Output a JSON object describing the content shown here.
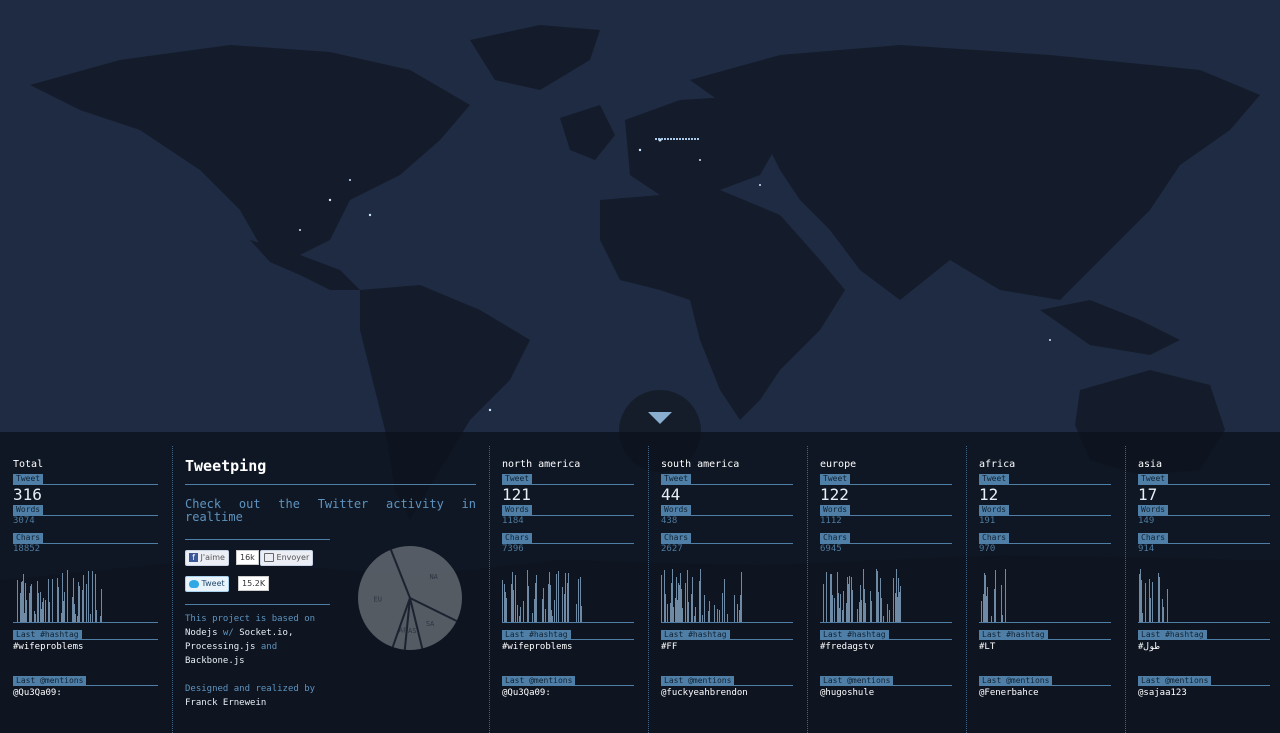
{
  "app": {
    "title": "Tweetping"
  },
  "toggle": {
    "icon": "chevron-down-icon"
  },
  "labels": {
    "tweet": "Tweet",
    "words": "Words",
    "chars": "Chars",
    "hashtag": "Last #hashtag",
    "mentions": "Last @mentions"
  },
  "total": {
    "name": "Total",
    "tweet": "316",
    "words": "3074",
    "chars": "18852",
    "hashtag": "#wifeproblems",
    "mention": "@Qu3Qa09:"
  },
  "about": {
    "title": "Tweetping",
    "subtitle": "Check out the Twitter activity in realtime",
    "like_label": "J'aime",
    "like_count": "16k",
    "send_label": "Envoyer",
    "tweet_label": "Tweet",
    "tweet_count": "15.2K",
    "based_on": "This project is based on",
    "tech1": "Nodejs",
    "w": " w/ ",
    "tech2": "Socket.io,",
    "tech3": "Processing.js",
    "and": " and",
    "tech4": "Backbone.js",
    "designed": "Designed and realized by",
    "author": "Franck Ernewein"
  },
  "pie": {
    "type": "pie",
    "slices": [
      {
        "label": "NA",
        "value": 121
      },
      {
        "label": "SA",
        "value": 44
      },
      {
        "label": "AS",
        "value": 17
      },
      {
        "label": "AF",
        "value": 12
      },
      {
        "label": "EU",
        "value": 122
      }
    ]
  },
  "regions": [
    {
      "name": "north america",
      "tweet": "121",
      "words": "1184",
      "chars": "7396",
      "hashtag": "#wifeproblems",
      "mention": "@Qu3Qa09:"
    },
    {
      "name": "south america",
      "tweet": "44",
      "words": "438",
      "chars": "2627",
      "hashtag": "#FF",
      "mention": "@fuckyeahbrendon"
    },
    {
      "name": "europe",
      "tweet": "122",
      "words": "1112",
      "chars": "6945",
      "hashtag": "#fredagstv",
      "mention": "@hugoshule"
    },
    {
      "name": "africa",
      "tweet": "12",
      "words": "191",
      "chars": "970",
      "hashtag": "#LT",
      "mention": "@Fenerbahce"
    },
    {
      "name": "asia",
      "tweet": "17",
      "words": "149",
      "chars": "914",
      "hashtag": "#طول",
      "mention": "@sajaa123"
    }
  ],
  "colors": {
    "background": "#1e2b42",
    "land": "#141c2b",
    "accent": "#4f7fa6",
    "text_blue": "#5e93bf"
  }
}
